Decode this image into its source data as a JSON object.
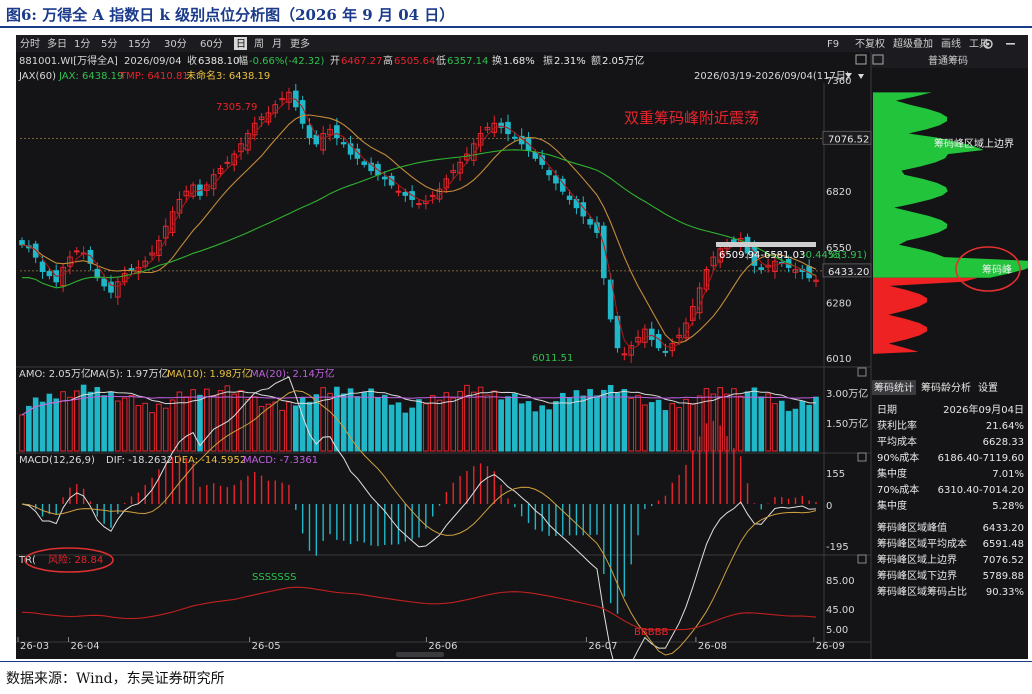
{
  "figure_title": "图6:  万得全 A 指数日 k 级别点位分析图（2026 年 9 月 04 日）",
  "source": "数据来源：Wind，东吴证券研究所",
  "toolbar": {
    "period_tabs": [
      "分时",
      "多日",
      "1分",
      "5分",
      "15分",
      "30分",
      "60分",
      "日",
      "周",
      "月",
      "更多"
    ],
    "active_tab": "日",
    "right_items": [
      "F9",
      "不复权",
      "超级叠加",
      "画线",
      "工具"
    ],
    "settings_icon": "gear-icon",
    "minimize_icon": "minus-icon"
  },
  "quote": {
    "code": "881001.WI[万得全A]",
    "date": "2026/09/04",
    "close_label": "收",
    "close": "6388.10",
    "change_label": "幅",
    "change": "-0.66%(-42.32)",
    "open_label": "开",
    "open": "6467.27",
    "high_label": "高",
    "high": "6505.64",
    "low_label": "低",
    "low": "6357.14",
    "turnover_label": "换",
    "turnover": "1.68%",
    "amplitude_label": "振",
    "amplitude": "2.31%",
    "amount_label": "额",
    "amount": "2.05万亿"
  },
  "indicator_line": {
    "name": "JAX(60)",
    "jax": "JAX: 6438.19",
    "tmp": "TMP: 6410.81",
    "unnamed": "未命名3: 6438.19"
  },
  "range_label": "2026/03/19-2026/09/04(117日)",
  "panel_tabs": {
    "top": "普通筹码",
    "stats": [
      "筹码统计",
      "筹码龄分析",
      "设置"
    ],
    "active_stat": "筹码统计"
  },
  "annotations": {
    "headline": "双重筹码峰附近震荡",
    "upper_edge": "筹码峰区域上边界",
    "peak": "筹码峰",
    "high_mark": "7305.79",
    "low_mark": "6011.51",
    "zone_label": "6509.94-6581.03",
    "zone_right": "-0.44%(",
    "zone_right2": "553.91)",
    "macd_sell": "SSSSSSS",
    "macd_buy": "BBBBB"
  },
  "price_axis": {
    "labels": [
      "7360",
      "7090",
      "6820",
      "6550",
      "6280",
      "6010"
    ],
    "boxed": [
      "7076.52",
      "6433.20"
    ]
  },
  "volume_header": {
    "amo": "AMO: 2.05万亿",
    "ma5": "MA(5): 1.97万亿",
    "ma10": "MA(10): 1.98万亿",
    "ma20": "MA(20): 2.14万亿",
    "axis": [
      "3.00万亿",
      "1.50万亿"
    ]
  },
  "macd_header": {
    "name": "MACD(12,26,9)",
    "dif": "DIF: -18.2632",
    "dea": "DEA: -14.5952",
    "macd": "MACD: -7.3361",
    "axis": [
      "155",
      "0",
      "-195"
    ]
  },
  "tr_header": {
    "name": "TR(",
    "risk": "风险: 28.84",
    "axis": [
      "85.00",
      "45.00",
      "5.00"
    ]
  },
  "date_axis": [
    "26-03",
    "26-04",
    "26-05",
    "26-06",
    "26-07",
    "26-08",
    "26-09"
  ],
  "chip_stats": [
    {
      "label": "日期",
      "value": "2026年09月04日"
    },
    {
      "label": "获利比率",
      "value": "21.64%"
    },
    {
      "label": "平均成本",
      "value": "6628.33"
    },
    {
      "label": "90%成本",
      "value": "6186.40-7119.60"
    },
    {
      "label": "集中度",
      "value": "7.01%"
    },
    {
      "label": "70%成本",
      "value": "6310.40-7014.20"
    },
    {
      "label": "集中度",
      "value": "5.28%"
    }
  ],
  "chip_peak_stats": [
    {
      "label": "筹码峰区域峰值",
      "value": "6433.20"
    },
    {
      "label": "筹码峰区域平均成本",
      "value": "6591.48"
    },
    {
      "label": "筹码峰区域上边界",
      "value": "7076.52"
    },
    {
      "label": "筹码峰区域下边界",
      "value": "5789.88"
    },
    {
      "label": "筹码峰区域筹码占比",
      "value": "90.33%"
    }
  ],
  "colors": {
    "up": "#e8242c",
    "down": "#20b8c8",
    "ma_short": "#c48a3a",
    "ma_long": "#30b030",
    "chip_upper": "#22c43c",
    "chip_lower": "#ee2222",
    "circle": "#e03030"
  },
  "chart_data": {
    "type": "candlestick",
    "x_range": [
      "2026/03/19",
      "2026/09/04"
    ],
    "bars": 117,
    "ylim": [
      6010,
      7360
    ],
    "key_points": [
      {
        "label": "7305.79",
        "type": "high",
        "date": "2026-05"
      },
      {
        "label": "6011.51",
        "type": "low",
        "date": "2026-07"
      }
    ],
    "closes_approx": [
      6560,
      6545,
      6500,
      6430,
      6410,
      6380,
      6450,
      6500,
      6530,
      6520,
      6470,
      6400,
      6360,
      6330,
      6380,
      6420,
      6440,
      6450,
      6480,
      6520,
      6580,
      6650,
      6720,
      6780,
      6820,
      6850,
      6800,
      6850,
      6900,
      6930,
      6960,
      7000,
      7050,
      7100,
      7150,
      7180,
      7200,
      7240,
      7270,
      7300,
      7230,
      7150,
      7080,
      7050,
      7100,
      7120,
      7080,
      7050,
      7000,
      6980,
      6950,
      6920,
      6900,
      6880,
      6850,
      6820,
      6800,
      6780,
      6760,
      6770,
      6800,
      6830,
      6880,
      6920,
      6960,
      7000,
      7050,
      7100,
      7130,
      7150,
      7130,
      7100,
      7080,
      7050,
      7020,
      6980,
      6950,
      6900,
      6860,
      6820,
      6780,
      6740,
      6700,
      6660,
      6620,
      6400,
      6200,
      6060,
      6030,
      6070,
      6110,
      6150,
      6100,
      6060,
      6040,
      6080,
      6120,
      6180,
      6260,
      6350,
      6440,
      6500,
      6540,
      6560,
      6570,
      6590,
      6520,
      6460,
      6440,
      6460,
      6480,
      6470,
      6450,
      6440,
      6430,
      6400,
      6388
    ]
  }
}
